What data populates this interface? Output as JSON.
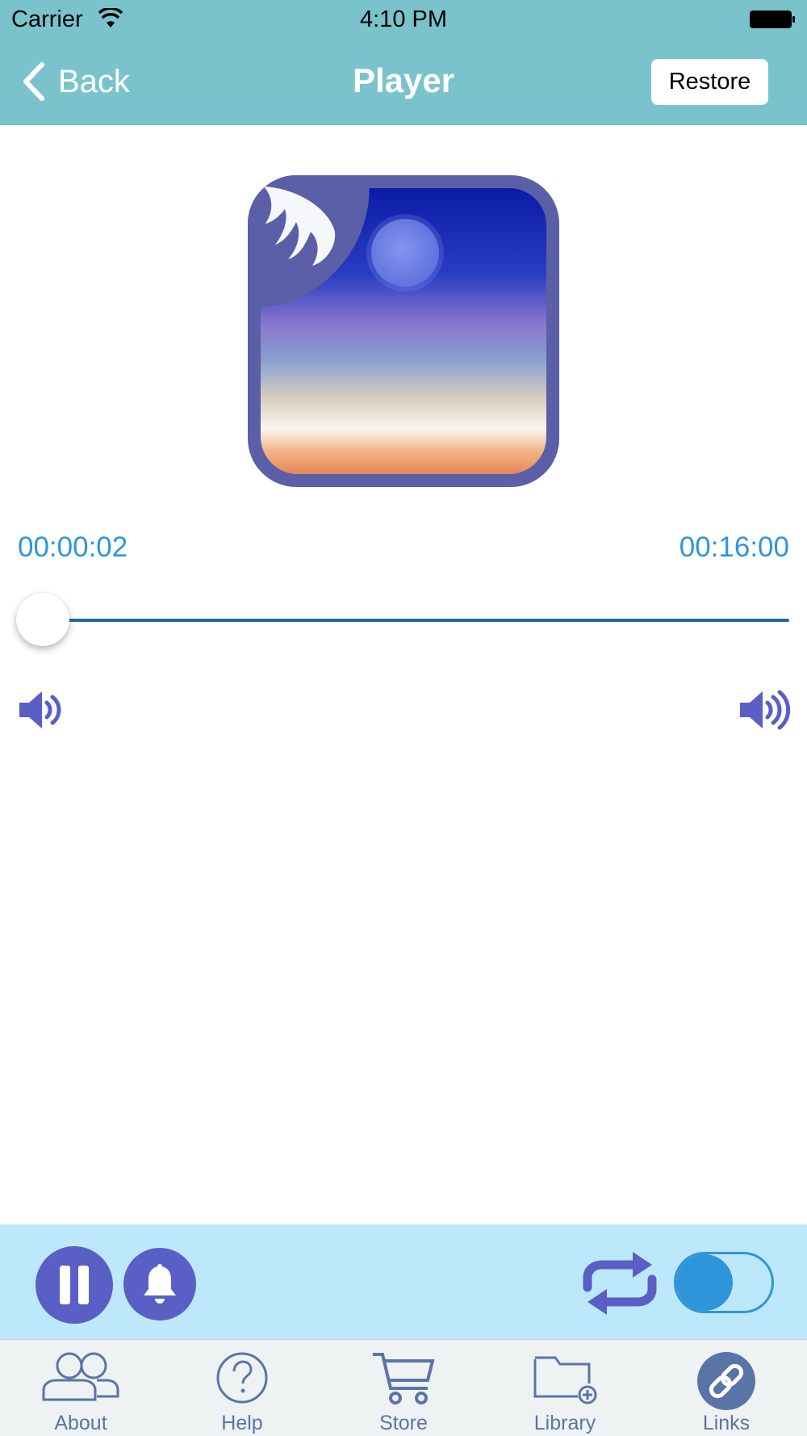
{
  "status_bar": {
    "carrier": "Carrier",
    "time": "4:10 PM",
    "wifi_icon": "wifi-icon",
    "battery_icon": "battery-icon"
  },
  "nav": {
    "back_label": "Back",
    "title": "Player",
    "restore_label": "Restore"
  },
  "player": {
    "artwork_icon": "moon-over-sea-artwork",
    "elapsed": "00:00:02",
    "total": "00:16:00",
    "progress_fraction": 0.002,
    "volume_low_icon": "speaker-low-icon",
    "volume_high_icon": "speaker-high-icon"
  },
  "controls": {
    "pause_icon": "pause-icon",
    "alarm_icon": "bell-icon",
    "repeat_icon": "repeat-icon",
    "repeat_toggle_on": false
  },
  "tabs": [
    {
      "label": "About",
      "icon": "users-icon",
      "selected": false
    },
    {
      "label": "Help",
      "icon": "question-icon",
      "selected": false
    },
    {
      "label": "Store",
      "icon": "cart-icon",
      "selected": false
    },
    {
      "label": "Library",
      "icon": "folder-add-icon",
      "selected": false
    },
    {
      "label": "Links",
      "icon": "link-icon",
      "selected": true
    }
  ],
  "colors": {
    "header": "#7ac3cc",
    "accent_blue": "#2f95da",
    "button_purple": "#5a5fc6",
    "control_bar": "#bde8fb",
    "tab_icon": "#5a74a8"
  }
}
